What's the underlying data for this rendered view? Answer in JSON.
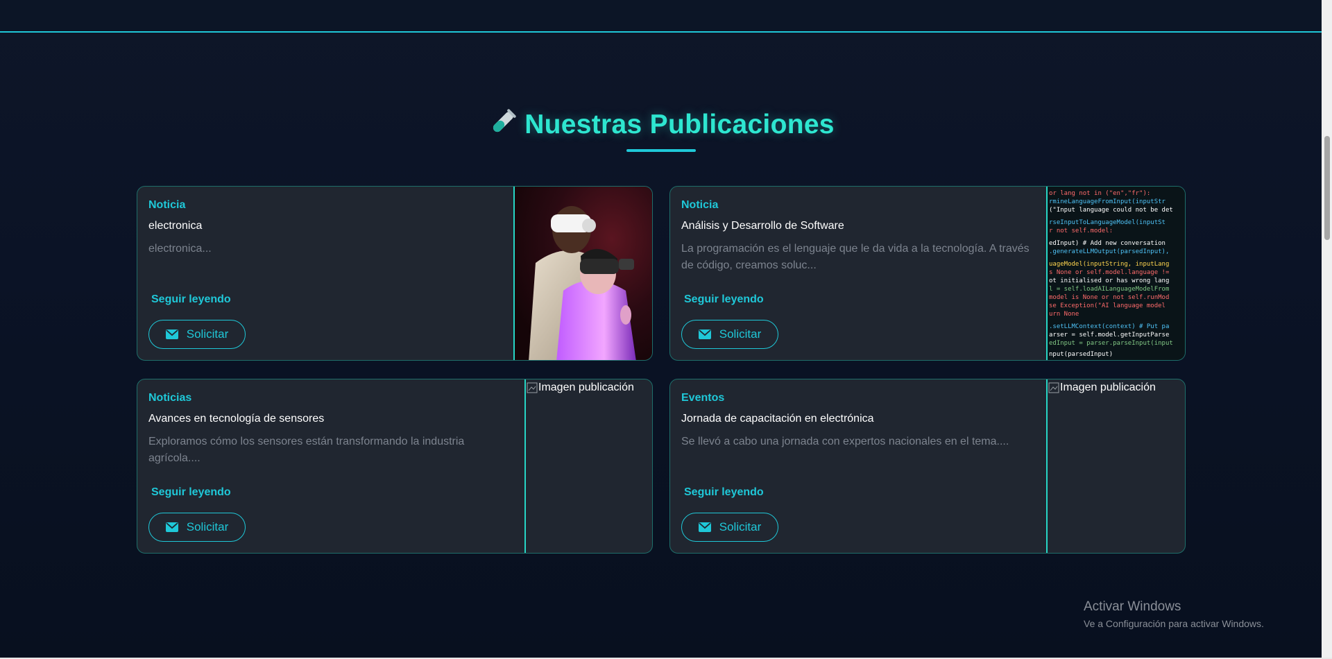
{
  "section": {
    "title": "Nuestras Publicaciones",
    "icon": "test-tube-icon",
    "accent_color": "#2ee6d0"
  },
  "cards": [
    {
      "category": "Noticia",
      "title": "electronica",
      "excerpt": "electronica...",
      "read_more": "Seguir leyendo",
      "button_label": "Solicitar",
      "image": "vr-headset-photo"
    },
    {
      "category": "Noticia",
      "title": "Análisis y Desarrollo de Software",
      "excerpt": "La programación es el lenguaje que le da vida a la tecnología. A través de código, creamos soluc...",
      "read_more": "Seguir leyendo",
      "button_label": "Solicitar",
      "image": "code-screen-photo"
    },
    {
      "category": "Noticias",
      "title": "Avances en tecnología de sensores",
      "excerpt": "Exploramos cómo los sensores están transformando la industria agrícola....",
      "read_more": "Seguir leyendo",
      "button_label": "Solicitar",
      "image_alt": "Imagen publicación"
    },
    {
      "category": "Eventos",
      "title": "Jornada de capacitación en electrónica",
      "excerpt": "Se llevó a cabo una jornada con expertos nacionales en el tema....",
      "read_more": "Seguir leyendo",
      "button_label": "Solicitar",
      "image_alt": "Imagen publicación"
    }
  ],
  "os_watermark": {
    "line1": "Activar Windows",
    "line2": "Ve a Configuración para activar Windows."
  }
}
